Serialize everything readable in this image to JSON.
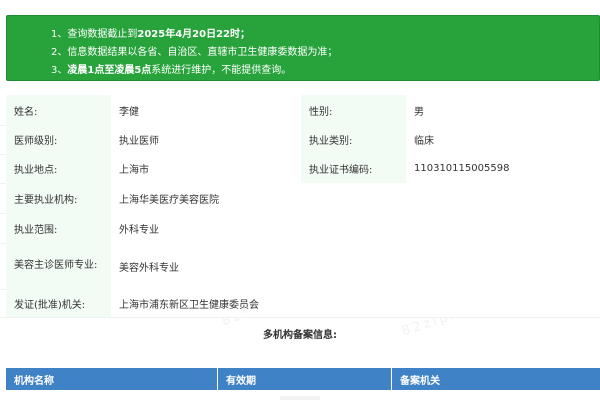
{
  "notice": {
    "line1_prefix": "1、查询数据截止到",
    "line1_bold": "2025年4月20日22时；",
    "line2": "2、信息数据结果以各省、自治区、直辖市卫生健康委数据为准；",
    "line3_prefix": "3、",
    "line3_bold": "凌晨1点至凌晨5点",
    "line3_suffix": "系统进行维护，不能提供查询。"
  },
  "watermark": {
    "brand": "依品网",
    "site": "82zip.com"
  },
  "info": {
    "name_label": "姓名:",
    "name_value": "李健",
    "gender_label": "性别:",
    "gender_value": "男",
    "level_label": "医师级别:",
    "level_value": "执业医师",
    "type_label": "执业类别:",
    "type_value": "临床",
    "place_label": "执业地点:",
    "place_value": "上海市",
    "cert_label": "执业证书编码:",
    "cert_value": "110310115005598",
    "org_label": "主要执业机构:",
    "org_value": "上海华美医疗美容医院",
    "scope_label": "执业范围:",
    "scope_value": "外科专业",
    "beauty_label": "美容主诊医师专业:",
    "beauty_value": "美容外科专业",
    "issuer_label": "发证(批准)机关:",
    "issuer_value": "上海市浦东新区卫生健康委员会"
  },
  "multi_title": "多机构备案信息:",
  "table": {
    "headers": [
      "机构名称",
      "有效期",
      "备案机关"
    ]
  }
}
